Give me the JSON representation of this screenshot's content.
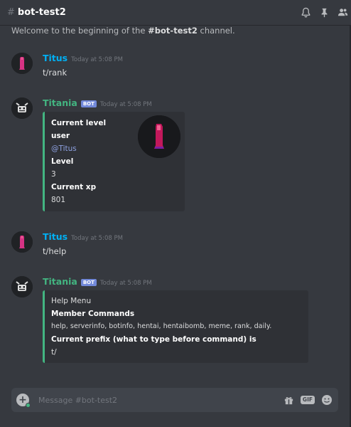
{
  "header": {
    "hash": "#",
    "channel_name": "bot-test2"
  },
  "welcome": {
    "prefix": "Welcome to the beginning of the ",
    "channel": "#bot-test2",
    "suffix": " channel."
  },
  "messages": [
    {
      "username": "Titus",
      "username_color": "#00b0f4",
      "timestamp": "Today at 5:08 PM",
      "text": "t/rank"
    },
    {
      "username": "Titania",
      "username_color": "#43b581",
      "bot_tag": "BOT",
      "timestamp": "Today at 5:08 PM",
      "embed": {
        "lines": [
          "Current level",
          "user",
          "@Titus",
          "Level",
          "3",
          "Current xp",
          "801"
        ]
      }
    },
    {
      "username": "Titus",
      "username_color": "#00b0f4",
      "timestamp": "Today at 5:08 PM",
      "text": "t/help"
    },
    {
      "username": "Titania",
      "username_color": "#43b581",
      "bot_tag": "BOT",
      "timestamp": "Today at 5:08 PM",
      "embed": {
        "title": "Help Menu",
        "lines": [
          "Member Commands",
          "help, serverinfo, botinfo, hentai, hentaibomb, meme, rank, daily.",
          "Current prefix (what to type before command) is",
          "t/"
        ]
      }
    }
  ],
  "composer": {
    "placeholder": "Message #bot-test2",
    "gif_label": "GIF"
  },
  "icons": {
    "top": [
      "bell-icon",
      "pin-icon",
      "members-icon"
    ],
    "composer": [
      "plus-icon",
      "gift-icon",
      "gif-icon",
      "emoji-icon"
    ]
  },
  "colors": {
    "background": "#36393f",
    "embed_bg": "#2f3136",
    "embed_border": "#43b581",
    "mention": "#8ea1e1",
    "bot_tag": "#7289da"
  }
}
